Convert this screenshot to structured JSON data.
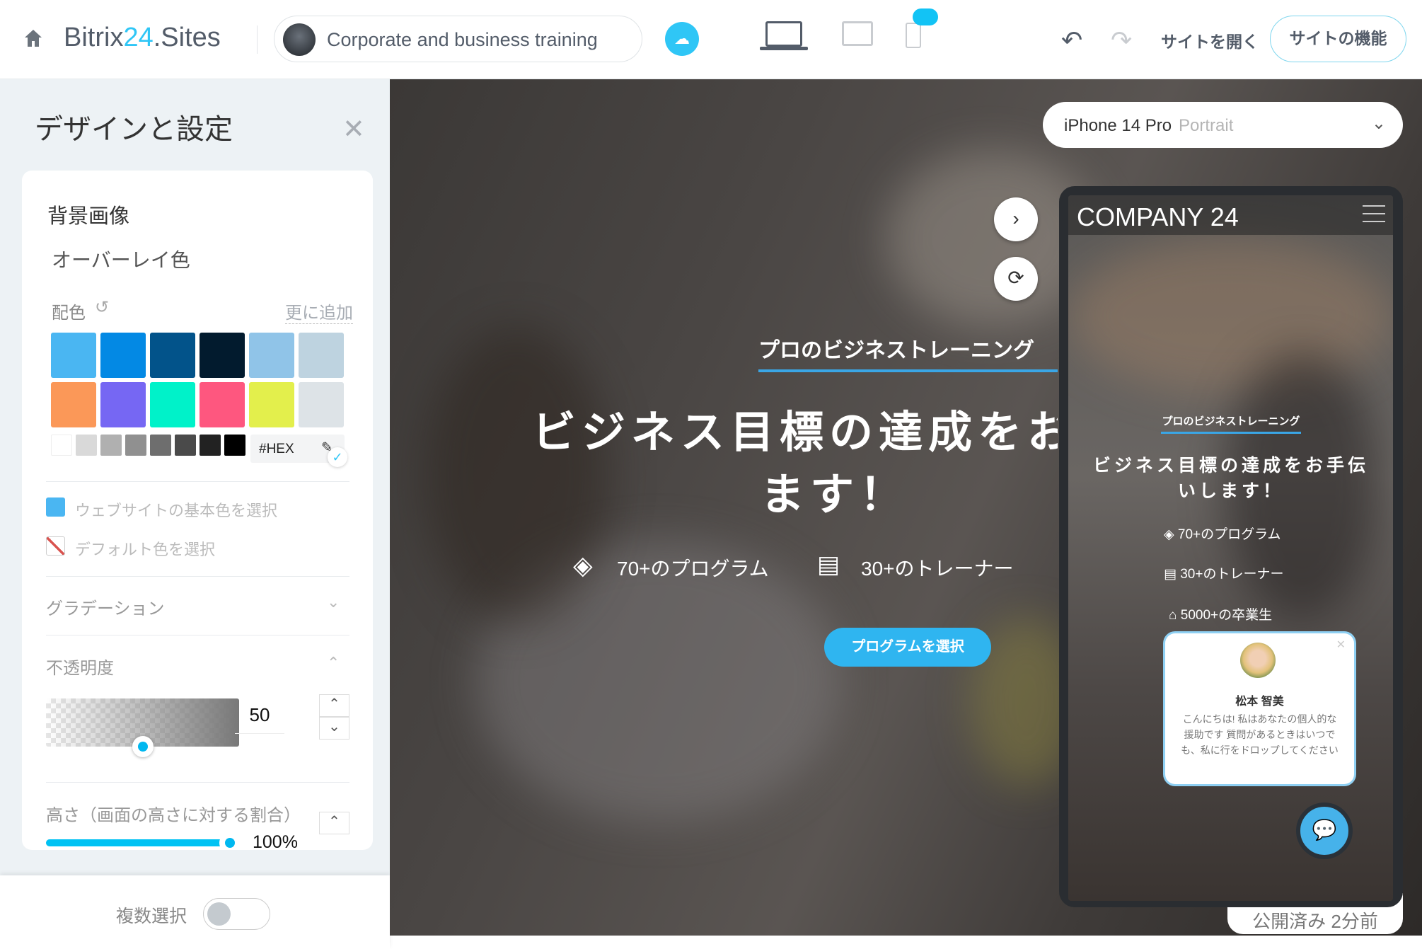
{
  "header": {
    "logo_main": "Bitrix",
    "logo_num": "24",
    "logo_suffix": ".Sites",
    "site_name": "Corporate and business training",
    "open_site": "サイトを開く",
    "site_features": "サイトの機能"
  },
  "panel": {
    "title": "デザインと設定",
    "section": "背景画像",
    "overlay": "オーバーレイ色",
    "palette_label": "配色",
    "add_more": "更に追加",
    "swatches_row1": [
      "#4ab6f2",
      "#0389e4",
      "#02538a",
      "#021b2e",
      "#90c4e8",
      "#bed3e0"
    ],
    "swatches_row2": [
      "#fb9858",
      "#7667f3",
      "#00f2c9",
      "#fe577f",
      "#e3ef4c",
      "#dde3e7"
    ],
    "grays": [
      "#ffffff",
      "#d9d9d9",
      "#b0b0b0",
      "#909090",
      "#6e6e6e",
      "#4a4a4a",
      "#222222",
      "#000000"
    ],
    "hex_placeholder": "#HEX",
    "site_color": "ウェブサイトの基本色を選択",
    "default_color": "デフォルト色を選択",
    "gradient": "グラデーション",
    "opacity": "不透明度",
    "opacity_value": "50",
    "height_label": "高さ（画面の高さに対する割合）",
    "height_value": "100%",
    "height_percent": 100,
    "opacity_percent": 50
  },
  "bottom": {
    "multi_select": "複数選択",
    "multi_select_on": false
  },
  "preview": {
    "device": "iPhone 14 Pro",
    "orientation": "Portrait",
    "subtitle": "プロのビジネストレーニング",
    "headline1": "ビジネス目標の達成をお",
    "headline2": "ます！",
    "stat1": "70+のプログラム",
    "stat2": "30+のトレーナー",
    "cta": "プログラムを選択",
    "published": "公開済み 2分前"
  },
  "phone": {
    "brand": "COMPANY 24",
    "subtitle": "プロのビジネストレーニング",
    "headline1": "ビジネス目標の達成をお手伝",
    "headline2": "いします！",
    "stat1": "70+のプログラム",
    "stat2": "30+のトレーナー",
    "stat3": "5000+の卒業生",
    "chat_name": "松本 智美",
    "chat_msg": "こんにちは! 私はあなたの個人的な援助です 質問があるときはいつでも、私に行をドロップしてください"
  },
  "colors": {
    "accent": "#2fc6f6",
    "text": "#535c69"
  }
}
